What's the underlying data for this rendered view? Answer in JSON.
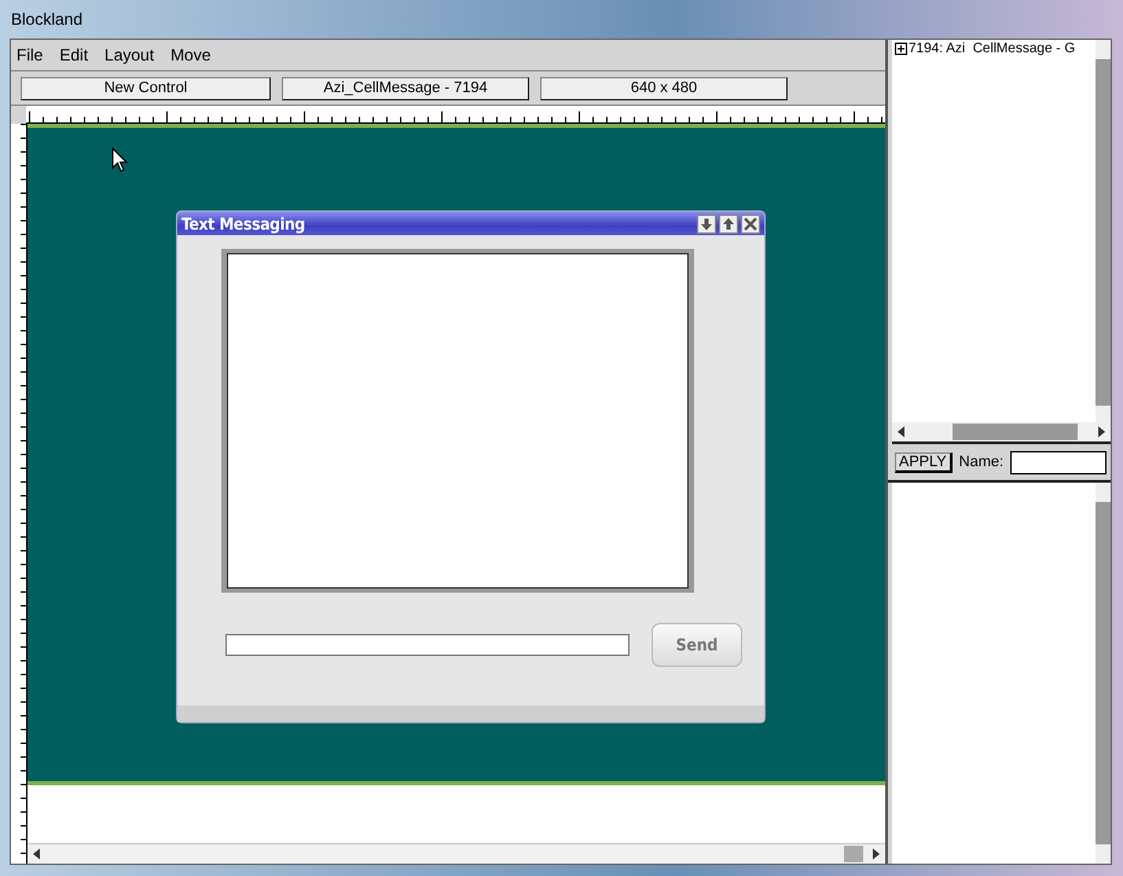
{
  "window": {
    "title": "Blockland"
  },
  "menu": [
    {
      "label": "File"
    },
    {
      "label": "Edit"
    },
    {
      "label": "Layout"
    },
    {
      "label": "Move"
    }
  ],
  "toolbar": [
    {
      "label": "New Control"
    },
    {
      "label": "Azi_CellMessage - 7194"
    },
    {
      "label": "640 x 480"
    }
  ],
  "dialog": {
    "title": "Text Messaging",
    "send_button": "Send"
  },
  "tree": {
    "items": [
      {
        "label": "7194: Azi  CellMessage - G",
        "expanded": false
      }
    ]
  },
  "inspector": {
    "apply_button": "APPLY",
    "name_label": "Name:"
  }
}
